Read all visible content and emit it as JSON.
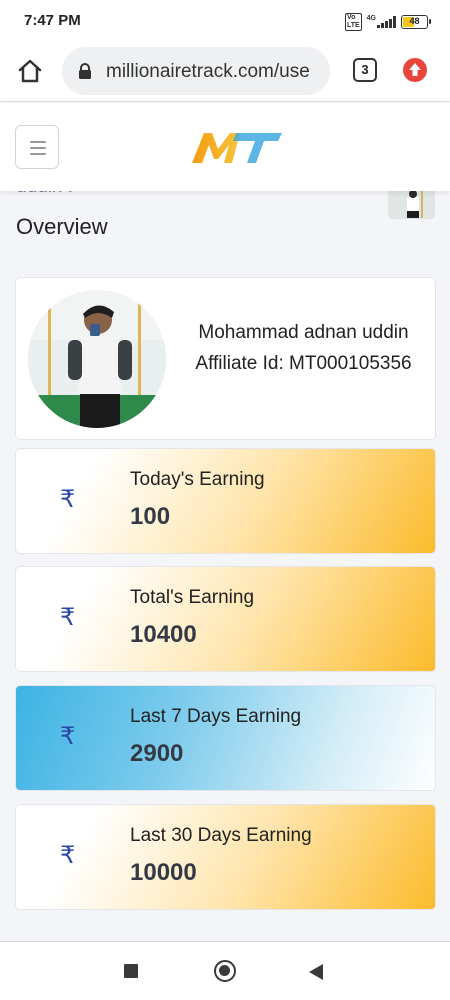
{
  "status_bar": {
    "time": "7:47 PM",
    "network": "4G",
    "volte": "Vo LTE",
    "battery": "48"
  },
  "browser": {
    "url": "millionairetrack.com/use",
    "tab_count": "3",
    "icons": {
      "home": "home-icon",
      "lock": "lock-icon",
      "upgrade": "upgrade-arrow-icon"
    }
  },
  "site": {
    "logo_text": "MT",
    "menu_icon": "hamburger-icon"
  },
  "page": {
    "cut_text": "uddin !",
    "title": "Overview"
  },
  "profile": {
    "name": "Mohammad adnan uddin",
    "affiliate": "Affiliate Id: MT000105356"
  },
  "earnings": [
    {
      "label": "Today's Earning",
      "value": "100",
      "icon": "₹"
    },
    {
      "label": "Total's Earning",
      "value": "10400",
      "icon": "₹"
    },
    {
      "label": "Last 7 Days Earning",
      "value": "2900",
      "icon": "₹"
    },
    {
      "label": "Last 30 Days Earning",
      "value": "10000",
      "icon": "₹"
    }
  ],
  "colors": {
    "gold_accent": "#fbbb2c",
    "blue_accent": "#3cb3e4",
    "rupee_icon": "#2b48a6",
    "logo_orange": "#f5a623",
    "logo_blue": "#3fa9e0"
  }
}
